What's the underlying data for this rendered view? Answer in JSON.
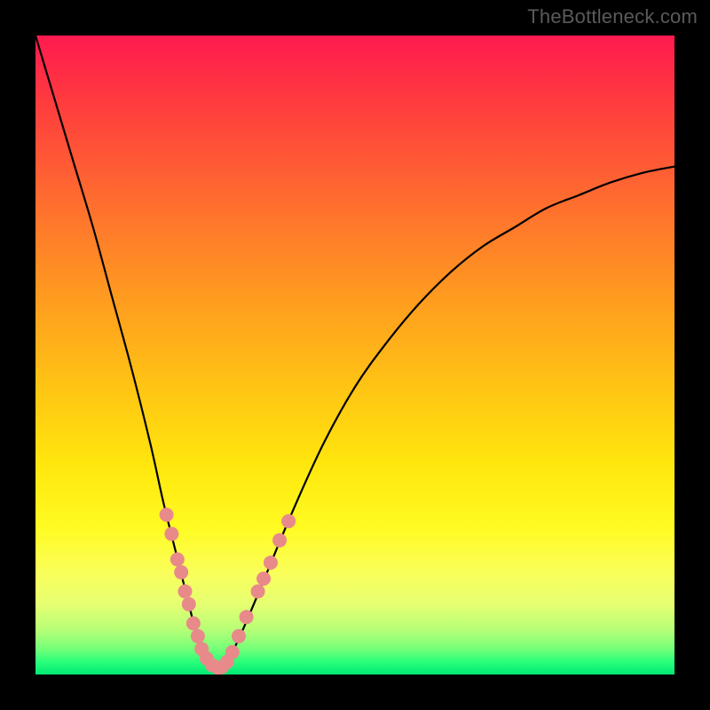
{
  "watermark": "TheBottleneck.com",
  "colors": {
    "curve_stroke": "#000000",
    "dot_fill": "#e88a8a",
    "dot_stroke": "#c46a6a"
  },
  "chart_data": {
    "type": "line",
    "title": "",
    "xlabel": "",
    "ylabel": "",
    "xlim": [
      0,
      100
    ],
    "ylim": [
      0,
      100
    ],
    "series": [
      {
        "name": "curve",
        "x": [
          0,
          3,
          6,
          9,
          12,
          15,
          18,
          20,
          22,
          24,
          25,
          26,
          27,
          28,
          29,
          30,
          32,
          35,
          40,
          45,
          50,
          55,
          60,
          65,
          70,
          75,
          80,
          85,
          90,
          95,
          100
        ],
        "y": [
          100,
          90,
          80,
          70,
          59,
          48,
          36,
          27,
          19,
          11,
          7,
          4,
          2,
          1,
          1,
          2,
          6,
          13,
          25,
          36,
          45,
          52,
          58,
          63,
          67,
          70,
          73,
          75,
          77,
          78.5,
          79.5
        ]
      }
    ],
    "dots": {
      "name": "markers",
      "points": [
        {
          "x": 20.5,
          "y": 25
        },
        {
          "x": 21.3,
          "y": 22
        },
        {
          "x": 22.2,
          "y": 18
        },
        {
          "x": 22.8,
          "y": 16
        },
        {
          "x": 23.4,
          "y": 13
        },
        {
          "x": 24.0,
          "y": 11
        },
        {
          "x": 24.7,
          "y": 8
        },
        {
          "x": 25.4,
          "y": 6
        },
        {
          "x": 26.0,
          "y": 4
        },
        {
          "x": 26.8,
          "y": 2.5
        },
        {
          "x": 27.6,
          "y": 1.5
        },
        {
          "x": 28.6,
          "y": 1
        },
        {
          "x": 29.2,
          "y": 1.2
        },
        {
          "x": 30.0,
          "y": 2
        },
        {
          "x": 30.8,
          "y": 3.5
        },
        {
          "x": 31.8,
          "y": 6
        },
        {
          "x": 33.0,
          "y": 9
        },
        {
          "x": 34.8,
          "y": 13
        },
        {
          "x": 35.7,
          "y": 15
        },
        {
          "x": 36.8,
          "y": 17.5
        },
        {
          "x": 38.2,
          "y": 21
        },
        {
          "x": 39.6,
          "y": 24
        }
      ],
      "radius": 8
    }
  }
}
